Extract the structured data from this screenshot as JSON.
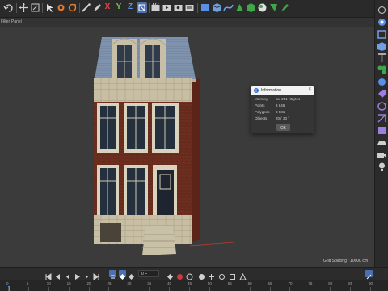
{
  "menubar": {
    "items": [
      "Filter",
      "Panel"
    ]
  },
  "toolbar": {
    "axis_x": "X",
    "axis_y": "Y",
    "axis_z": "Z",
    "icons": [
      "undo-icon",
      "move-icon",
      "scale-icon",
      "rotate-icon",
      "live-select-icon",
      "move-tool-icon",
      "scale-tool-icon",
      "rotate-tool-icon",
      "brush-icon",
      "pen-icon",
      "axis-x",
      "axis-y",
      "axis-z",
      "coordinate-system-icon",
      "render-region-icon",
      "render-view-icon",
      "render-settings-icon",
      "render-queue-icon",
      "interactive-render-icon",
      "cube-icon",
      "spline-icon",
      "nurbs-icon",
      "subdivision-icon",
      "deformer-icon",
      "environment-icon",
      "light-icon",
      "camera-icon"
    ]
  },
  "info_dialog": {
    "title": "Information",
    "close": "×",
    "rows": [
      {
        "key": "Memory",
        "value": "ca. 251 KBytes"
      },
      {
        "key": "Points",
        "value": "3 846"
      },
      {
        "key": "Polygons",
        "value": "3 531"
      },
      {
        "key": "Objects",
        "value": "20 ( 30 )"
      }
    ],
    "ok": "OK"
  },
  "viewport": {
    "grid_spacing": "Grid Spacing : 10000 cm"
  },
  "timeline": {
    "frame": "0 F",
    "ticks": [
      "0",
      "5",
      "10",
      "15",
      "20",
      "25",
      "30",
      "35",
      "40",
      "45",
      "50",
      "55",
      "60",
      "65",
      "70",
      "75",
      "80",
      "85",
      "90"
    ]
  },
  "colors": {
    "accent": "#5b8ee0",
    "toolbar_bg": "#2a2a2a",
    "viewport_bg": "#3b3b3b"
  }
}
